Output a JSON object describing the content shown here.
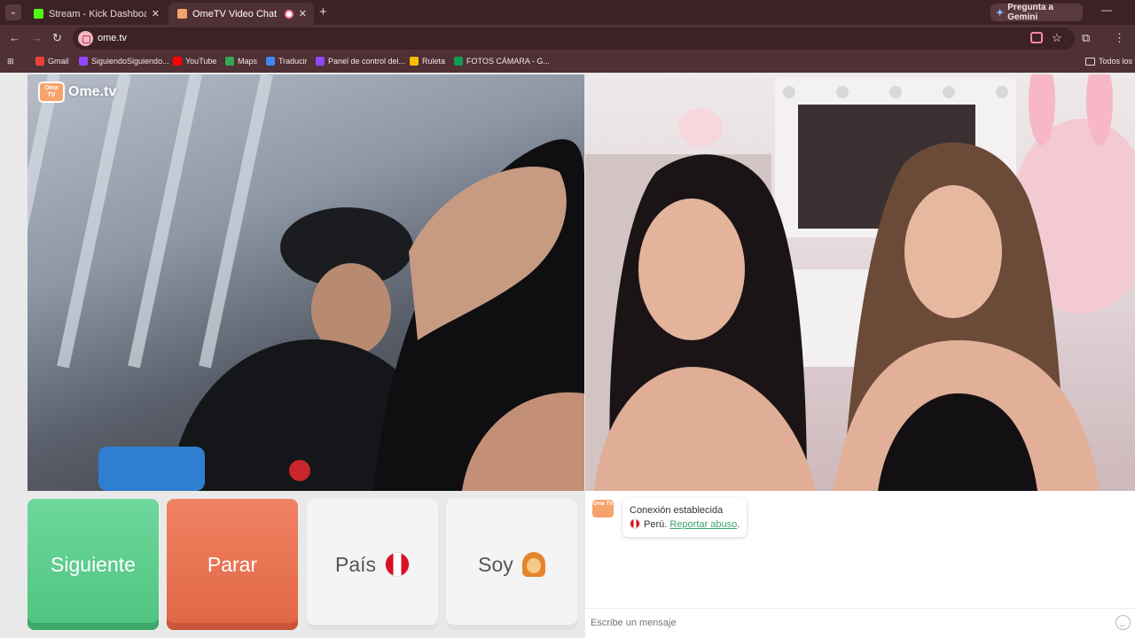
{
  "browser": {
    "tabs": [
      {
        "label": "Stream - Kick Dashboard",
        "favicon_color": "#53fc18",
        "active": false
      },
      {
        "label": "OmeTV Video Chat — Ome",
        "favicon_color": "#f6a26b",
        "active": true
      }
    ],
    "gemini_button": "Pregunta a Gemini",
    "address": "ome.tv",
    "bookmarks": [
      {
        "label": "Gmail",
        "icon": "gmail-icon",
        "color": "#ea4335"
      },
      {
        "label": "SiguiendoSiguiendo...",
        "icon": "twitch-icon",
        "color": "#9146ff"
      },
      {
        "label": "YouTube",
        "icon": "youtube-icon",
        "color": "#ff0000"
      },
      {
        "label": "Maps",
        "icon": "maps-icon",
        "color": "#34a853"
      },
      {
        "label": "Traducir",
        "icon": "translate-icon",
        "color": "#4285f4"
      },
      {
        "label": "Panel de control del...",
        "icon": "twitch-icon",
        "color": "#9146ff"
      },
      {
        "label": "Ruleta",
        "icon": "roulette-icon",
        "color": "#fbbc05"
      },
      {
        "label": "FOTOS CÁMARA - G...",
        "icon": "drive-icon",
        "color": "#0f9d58"
      }
    ],
    "bookmarks_folder": "Todos los m"
  },
  "app": {
    "logo_text": "Ome.tv",
    "logo_badge": "Ome TV",
    "buttons": {
      "next": "Siguiente",
      "stop": "Parar",
      "country": "País",
      "gender": "Soy"
    },
    "chat": {
      "status": "Conexión establecida",
      "country": "Perú.",
      "report": "Reportar abuso",
      "report_suffix": ".",
      "input_placeholder": "Escribe un mensaje"
    }
  }
}
